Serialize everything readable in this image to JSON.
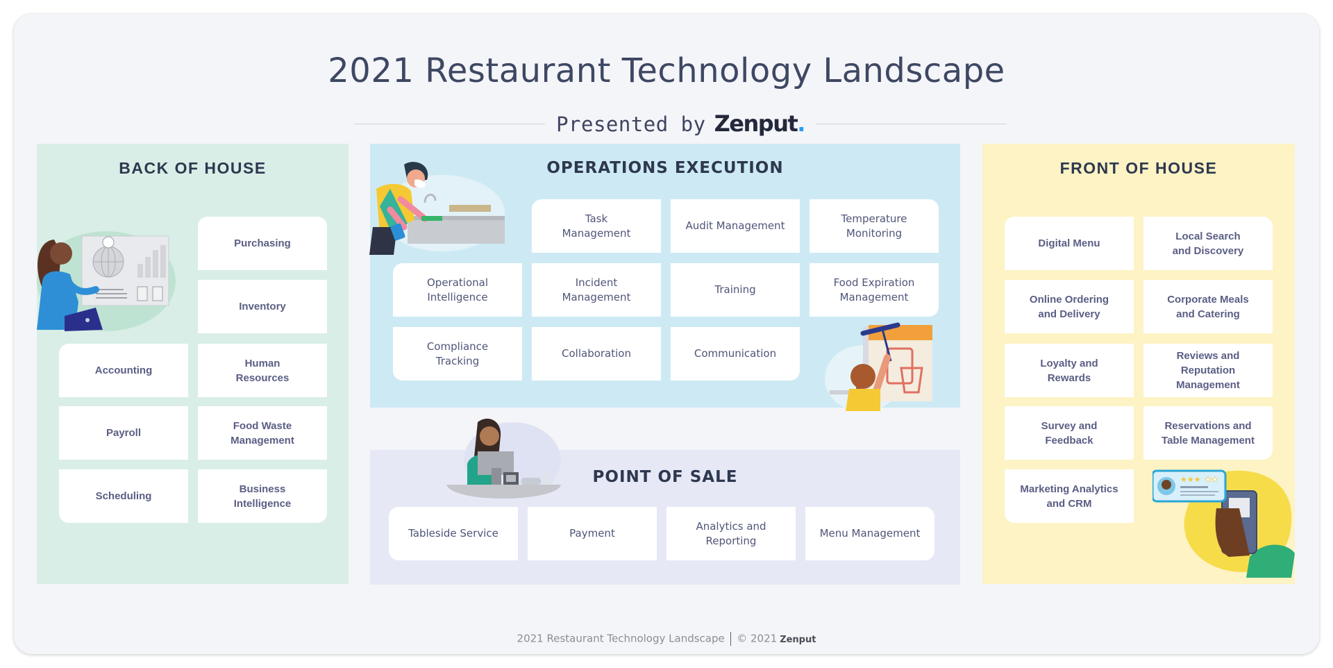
{
  "header": {
    "title": "2021 Restaurant Technology Landscape",
    "presented_by": "Presented by",
    "brand": "Zenput",
    "brand_dot": "."
  },
  "colors": {
    "back_of_house": "#d9eee6",
    "operations_execution": "#cdeaf4",
    "point_of_sale": "#e6e8f5",
    "front_of_house": "#fdf3c4",
    "card_text": "#5a5e84",
    "heading_text": "#2e3850",
    "brand_accent": "#2a9df4"
  },
  "sections": {
    "back_of_house": {
      "title": "BACK OF HOUSE",
      "illustration": "woman-with-laptop-dashboard-icon",
      "items": [
        "Purchasing",
        "Inventory",
        "Accounting",
        "Human\nResources",
        "Payroll",
        "Food Waste\nManagement",
        "Scheduling",
        "Business\nIntelligence"
      ]
    },
    "operations_execution": {
      "title": "OPERATIONS EXECUTION",
      "illustrations": [
        "worker-cleaning-counter-icon",
        "worker-hanging-poster-icon"
      ],
      "items": [
        "Task\nManagement",
        "Audit Management",
        "Temperature\nMonitoring",
        "Operational\nIntelligence",
        "Incident\nManagement",
        "Training",
        "Food Expiration\nManagement",
        "Compliance\nTracking",
        "Collaboration",
        "Communication"
      ]
    },
    "point_of_sale": {
      "title": "POINT OF SALE",
      "illustration": "cashier-at-pos-terminal-icon",
      "items": [
        "Tableside Service",
        "Payment",
        "Analytics and\nReporting",
        "Menu Management"
      ]
    },
    "front_of_house": {
      "title": "FRONT OF HOUSE",
      "illustration": "phone-review-icon",
      "review_rating": 3,
      "review_max": 5,
      "items": [
        "Digital Menu",
        "Local Search\nand Discovery",
        "Online Ordering\nand Delivery",
        "Corporate Meals\nand Catering",
        "Loyalty and\nRewards",
        "Reviews and Reputation\nManagement",
        "Survey and\nFeedback",
        "Reservations and\nTable Management",
        "Marketing Analytics\nand CRM"
      ]
    }
  },
  "footer": {
    "text": "2021 Restaurant Technology Landscape",
    "copyright": "© 2021",
    "brand": "Zenput"
  }
}
